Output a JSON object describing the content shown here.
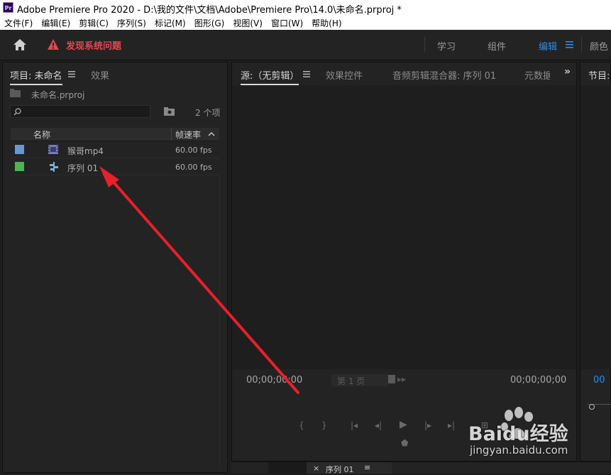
{
  "window": {
    "app_badge": "Pr",
    "title": "Adobe Premiere Pro 2020 - D:\\我的文件\\文档\\Adobe\\Premiere Pro\\14.0\\未命名.prproj *"
  },
  "menu": [
    "文件(F)",
    "编辑(E)",
    "剪辑(C)",
    "序列(S)",
    "标记(M)",
    "图形(G)",
    "视图(V)",
    "窗口(W)",
    "帮助(H)"
  ],
  "toolbar": {
    "warning_text": "发现系统问题",
    "workspaces": [
      "学习",
      "组件",
      "编辑",
      "颜色"
    ],
    "active_workspace": "编辑"
  },
  "project_panel": {
    "tab_active": "项目: 未命名",
    "tab_inactive": "效果",
    "file_name": "未命名.prproj",
    "item_count": "2 个项",
    "columns": [
      "名称",
      "帧速率"
    ],
    "rows": [
      {
        "color": "#6b96d6",
        "icon": "clip-icon",
        "name": "猴哥mp4",
        "fps": "60.00 fps"
      },
      {
        "color": "#4cb54c",
        "icon": "sequence-icon",
        "name": "序列 01",
        "fps": "60.00 fps"
      }
    ]
  },
  "source_panel": {
    "tabs": [
      "源:（无剪辑）",
      "效果控件",
      "音频剪辑混合器: 序列 01",
      "元数据"
    ],
    "timecode_left": "00;00;00;00",
    "page_label": "第 1 页",
    "timecode_right": "00;00;00;00"
  },
  "program_panel": {
    "tab": "节目:",
    "timecode": "00"
  },
  "timeline": {
    "tab": "序列 01"
  },
  "watermark": {
    "brand": "Baidu经验",
    "url": "jingyan.baidu.com"
  },
  "colors": {
    "accent": "#2d8ceb",
    "warning": "#e34850",
    "arrow": "#e8202a"
  }
}
